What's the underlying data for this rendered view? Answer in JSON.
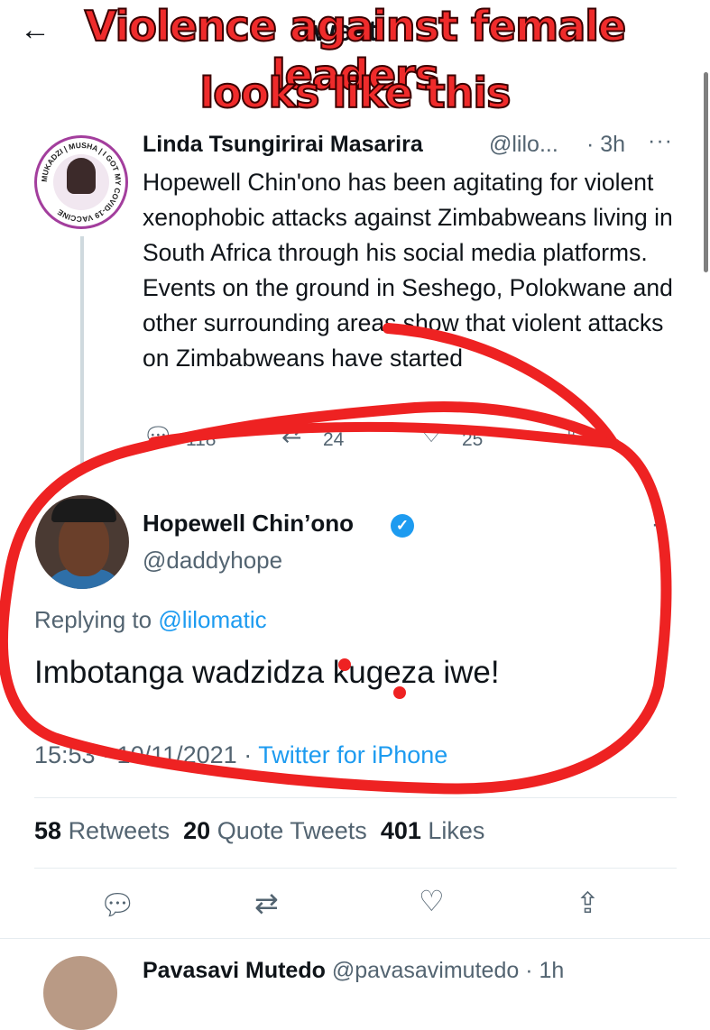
{
  "header": {
    "back_icon": "arrow-left-icon",
    "title": "Tweet"
  },
  "caption": {
    "line1": "Violence against female leaders",
    "line2": "looks like this",
    "color": "#ef2b2b"
  },
  "tweet1": {
    "name": "Linda Tsungirirai Masarira",
    "handle": "@lilo...",
    "time": "· 3h",
    "more": "···",
    "avatar_text": "MUKADZI | MUSHA | I GOT MY COVID-19 VACCINE",
    "body": "Hopewell Chin'ono has been agitating for violent xenophobic attacks against Zimbabweans living in South Africa through his social media platforms. Events on the ground in Seshego, Polokwane and other surrounding  areas show that violent attacks on Zimbabweans have started",
    "replies": "118",
    "retweets": "24",
    "likes": "25"
  },
  "tweet2": {
    "name": "Hopewell Chin’ono",
    "handle": "@daddyhope",
    "more": "·",
    "replying_prefix": "Replying to",
    "replying_to": "@lilomatic",
    "body": "Imbotanga wadzidza kugeza iwe!",
    "time": "15:53 · 10/11/2021 ·",
    "source": "Twitter for iPhone",
    "retweet_count": "58",
    "retweet_label": "Retweets",
    "quote_count": "20",
    "quote_label": "Quote Tweets",
    "like_count": "401",
    "like_label": "Likes"
  },
  "next_reply": {
    "name": "Pavasavi Mutedo",
    "handle": "@pavasavimutedo",
    "time": "· 1h",
    "more": "···"
  },
  "colors": {
    "accent": "#1d9bf0",
    "annotation": "#ee2222"
  }
}
